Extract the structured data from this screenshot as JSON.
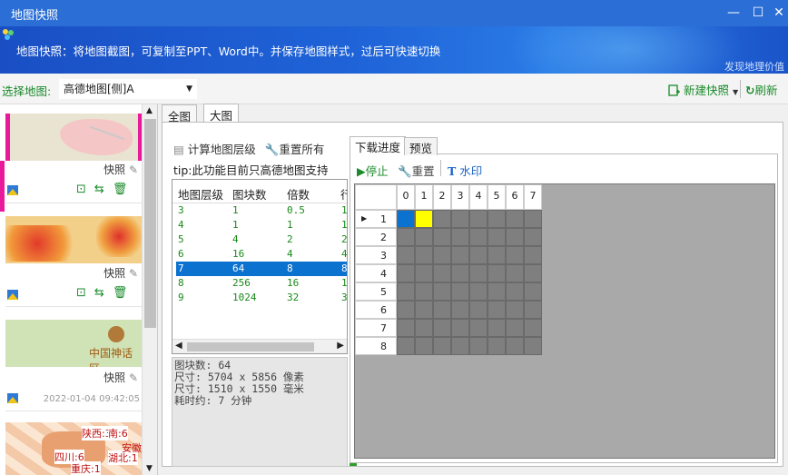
{
  "window": {
    "title": "地图快照",
    "controls": [
      "—",
      "☐",
      "✕"
    ]
  },
  "banner": {
    "description": "地图快照：将地图截图，可复制至PPT、Word中。并保存地图样式，过后可快速切换",
    "tagline": "发现地理价值"
  },
  "toolbar": {
    "select_label": "选择地图:",
    "selected_map": "高德地图[侧]A",
    "new_snapshot": "新建快照",
    "refresh": "刷新"
  },
  "snapshots": [
    {
      "label": "快照",
      "date": ""
    },
    {
      "label": "快照",
      "date": ""
    },
    {
      "label": "快照",
      "date": "2022-01-04 09:42:05",
      "map_text": "中国神话区"
    },
    {
      "label": "快照",
      "date": "",
      "map_labels": [
        "陕西:3",
        "南:6",
        "四川:6",
        "湖北:1",
        "重庆:1",
        "安徽"
      ]
    }
  ],
  "tabs": {
    "full": "全图",
    "large": "大图",
    "active": "large"
  },
  "left": {
    "calc_levels": "计算地图层级",
    "reset_all": "重置所有",
    "tip": "tip:此功能目前只高德地图支持",
    "columns": [
      "地图层级",
      "图块数",
      "倍数",
      "行"
    ],
    "rows": [
      {
        "level": "3",
        "tiles": "1",
        "mult": "0.5",
        "r": "1"
      },
      {
        "level": "4",
        "tiles": "1",
        "mult": "1",
        "r": "1"
      },
      {
        "level": "5",
        "tiles": "4",
        "mult": "2",
        "r": "2"
      },
      {
        "level": "6",
        "tiles": "16",
        "mult": "4",
        "r": "4"
      },
      {
        "level": "7",
        "tiles": "64",
        "mult": "8",
        "r": "8"
      },
      {
        "level": "8",
        "tiles": "256",
        "mult": "16",
        "r": "1"
      },
      {
        "level": "9",
        "tiles": "1024",
        "mult": "32",
        "r": "3"
      }
    ],
    "selected_row": 4,
    "info": [
      "图块数: 64",
      "尺寸: 5704 x 5856 像素",
      "尺寸: 1510 x 1550 毫米",
      "耗时约: 7 分钟"
    ]
  },
  "right": {
    "tabs": [
      "下载进度",
      "预览"
    ],
    "stop": "停止",
    "reset": "重置",
    "watermark": "水印",
    "col_headers": [
      "0",
      "1",
      "2",
      "3",
      "4",
      "5",
      "6",
      "7"
    ],
    "row_headers": [
      "1",
      "2",
      "3",
      "4",
      "5",
      "6",
      "7",
      "8"
    ],
    "progress_states": {
      "0-0": "downloading",
      "0-1": "pending-highlight"
    },
    "colors": {
      "done": "#0b72d0",
      "active": "#ffff00",
      "idle": "#7f7f7f"
    }
  }
}
